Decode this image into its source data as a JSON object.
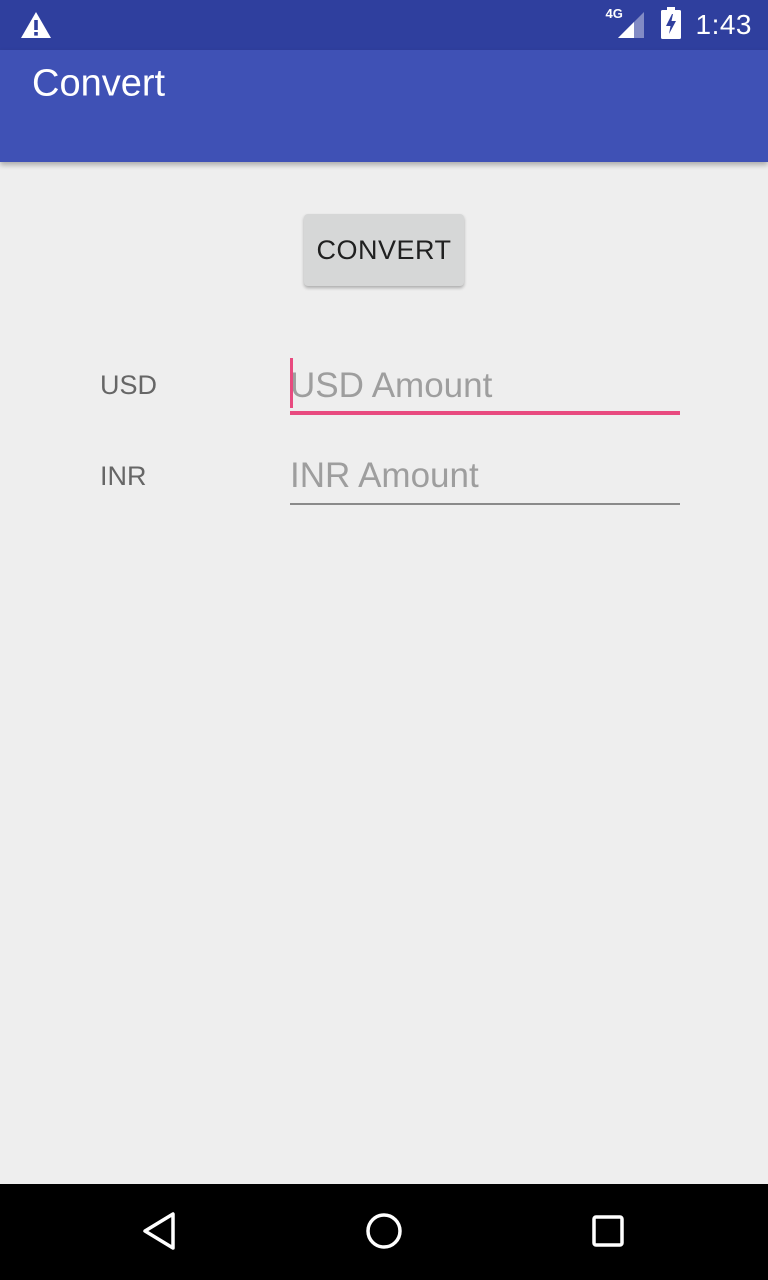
{
  "status_bar": {
    "network_type": "4G",
    "time": "1:43",
    "icons": [
      "warning-icon",
      "signal-icon",
      "battery-charging-icon"
    ]
  },
  "app_bar": {
    "title": "Convert"
  },
  "main": {
    "convert_button_label": "CONVERT",
    "usd": {
      "label": "USD",
      "value": "",
      "placeholder": "USD Amount",
      "focused": true
    },
    "inr": {
      "label": "INR",
      "value": "",
      "placeholder": "INR Amount",
      "focused": false
    }
  },
  "nav_bar": {
    "icons": [
      "back-icon",
      "home-icon",
      "recents-icon"
    ]
  },
  "colors": {
    "status_bar": "#2f3f9e",
    "app_bar": "#3f51b5",
    "accent": "#e84a7f",
    "background": "#eeeeee"
  }
}
